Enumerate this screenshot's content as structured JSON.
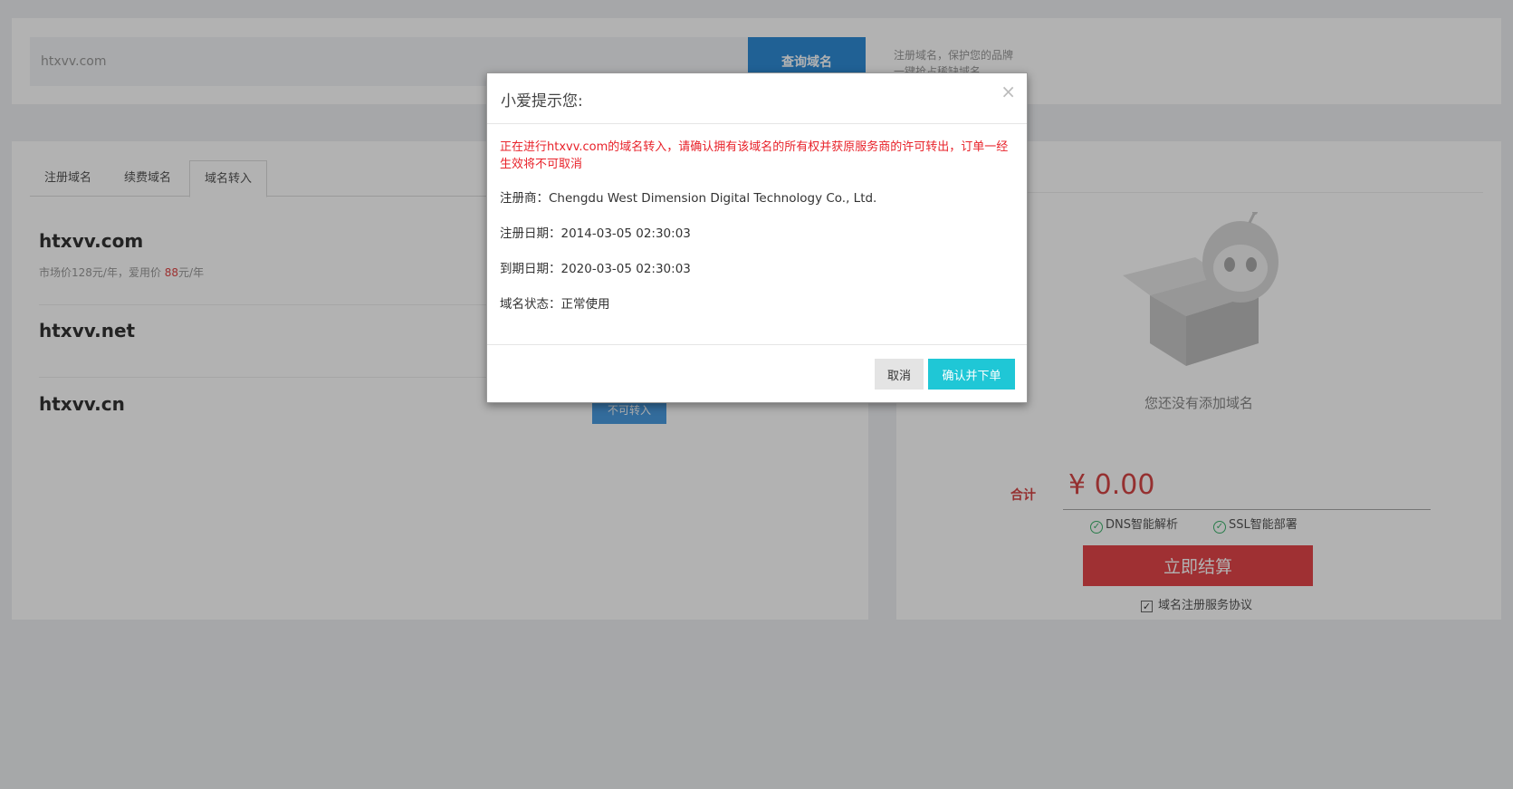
{
  "search": {
    "value": "htxvv.com",
    "button_label": "查询域名",
    "promo_line1": "注册域名，保护您的品牌",
    "promo_line2": "一键抢占稀缺域名"
  },
  "tabs": [
    {
      "label": "注册域名",
      "active": false
    },
    {
      "label": "续费域名",
      "active": false
    },
    {
      "label": "域名转入",
      "active": true
    }
  ],
  "domains": [
    {
      "name": "htxvv.com",
      "price_prefix": "市场价128元/年，爱用价 ",
      "price_value": "88",
      "price_suffix": "元/年"
    },
    {
      "name": "htxvv.net"
    },
    {
      "name": "htxvv.cn",
      "action_label": "不可转入"
    }
  ],
  "cart": {
    "empty_text": "您还没有添加域名",
    "total_label": "合计",
    "total_amount": "¥ 0.00",
    "features": [
      "DNS智能解析",
      "SSL智能部署"
    ],
    "checkout_label": "立即结算",
    "agreement_label": "域名注册服务协议",
    "agreement_checked": true
  },
  "modal": {
    "title": "小爱提示您:",
    "close_glyph": "×",
    "warning": "正在进行htxvv.com的域名转入，请确认拥有该域名的所有权并获原服务商的许可转出，订单一经生效将不可取消",
    "registrar": "注册商：Chengdu West Dimension Digital Technology Co., Ltd.",
    "reg_date": "注册日期：2014-03-05 02:30:03",
    "exp_date": "到期日期：2020-03-05 02:30:03",
    "status": "域名状态：正常使用",
    "cancel_label": "取消",
    "confirm_label": "确认并下单"
  },
  "colors": {
    "primary_blue": "#2f8bd6",
    "accent_red": "#e4454a",
    "confirm_cyan": "#1fc7d6",
    "warning_red": "#e8222a"
  }
}
